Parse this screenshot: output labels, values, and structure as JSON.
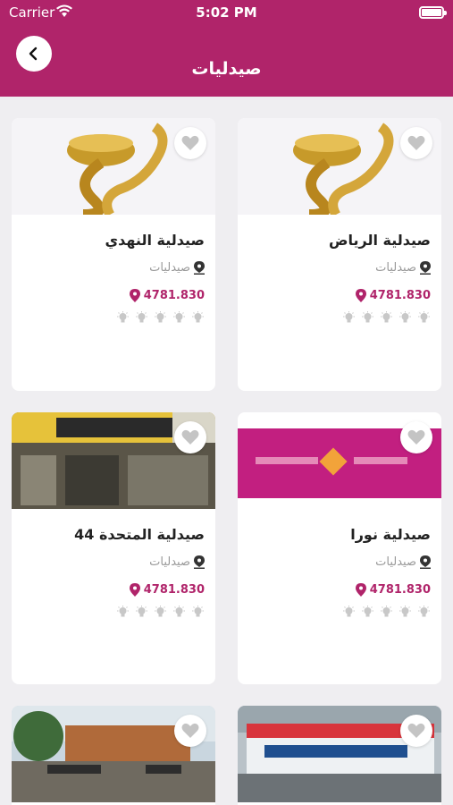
{
  "status_bar": {
    "carrier": "Carrier",
    "time": "5:02 PM"
  },
  "header": {
    "title": "صيدليات"
  },
  "colors": {
    "accent": "#b0246a",
    "background": "#efeef1"
  },
  "cards": [
    {
      "name": "صيدلية الرياض",
      "category": "صيدليات",
      "distance": "4781.830",
      "image": "pharmacy-cup-logo",
      "rating_icons": 5
    },
    {
      "name": "صيدلية النهدي",
      "category": "صيدليات",
      "distance": "4781.830",
      "image": "pharmacy-cup-logo",
      "rating_icons": 5
    },
    {
      "name": "صيدلية نورا",
      "category": "صيدليات",
      "distance": "4781.830",
      "image": "pink-sign-banner",
      "rating_icons": 5
    },
    {
      "name": "صيدلية المتحدة 44",
      "category": "صيدليات",
      "distance": "4781.830",
      "image": "storefront-photo",
      "rating_icons": 5
    },
    {
      "name": "",
      "category": "",
      "distance": "",
      "image": "oxygen-pharmacy-sign"
    },
    {
      "name": "",
      "category": "",
      "distance": "",
      "image": "street-building-photo"
    }
  ]
}
